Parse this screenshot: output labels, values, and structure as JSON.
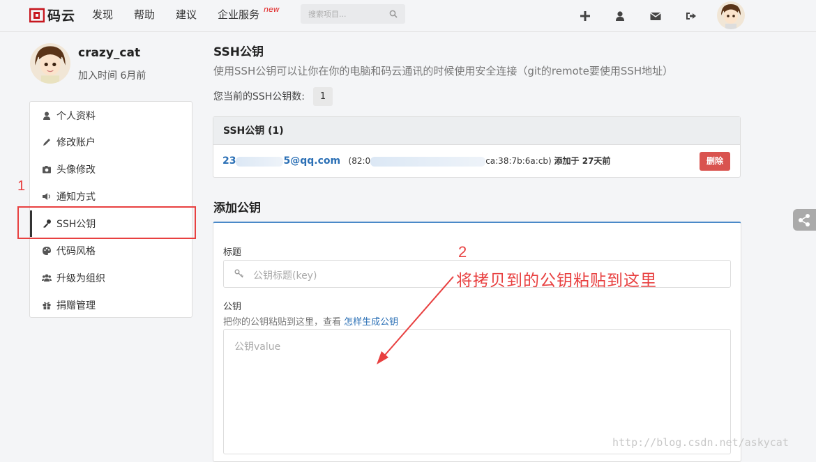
{
  "header": {
    "logo_text": "码云",
    "nav": [
      "发现",
      "帮助",
      "建议",
      "企业服务"
    ],
    "nav_badge": "new",
    "search_placeholder": "搜索项目..."
  },
  "profile": {
    "username": "crazy_cat",
    "joined": "加入时间 6月前"
  },
  "sidebar": {
    "items": [
      {
        "label": "个人资料",
        "icon": "user-icon"
      },
      {
        "label": "修改账户",
        "icon": "pencil-icon"
      },
      {
        "label": "头像修改",
        "icon": "camera-icon"
      },
      {
        "label": "通知方式",
        "icon": "volume-icon"
      },
      {
        "label": "SSH公钥",
        "icon": "key-icon"
      },
      {
        "label": "代码风格",
        "icon": "palette-icon"
      },
      {
        "label": "升级为组织",
        "icon": "users-icon"
      },
      {
        "label": "捐赠管理",
        "icon": "gift-icon"
      }
    ]
  },
  "ssh": {
    "title": "SSH公钥",
    "description": "使用SSH公钥可以让你在你的电脑和码云通讯的时候使用安全连接（git的remote要使用SSH地址）",
    "count_label": "您当前的SSH公钥数:",
    "count": "1",
    "panel_title": "SSH公钥 (1)",
    "key": {
      "email_prefix": "23",
      "email_suffix": "5@qq.com",
      "fingerprint_prefix": "(82:0",
      "fingerprint_suffix": "ca:38:7b:6a:cb)",
      "added": "添加于 27天前"
    },
    "delete_label": "删除"
  },
  "add_key": {
    "title": "添加公钥",
    "title_label": "标题",
    "title_placeholder": "公钥标题(key)",
    "key_label": "公钥",
    "key_hint": "把你的公钥粘贴到这里，查看",
    "key_hint_link": "怎样生成公钥",
    "key_placeholder": "公钥value"
  },
  "annotations": {
    "marker_1": "1",
    "marker_2": "2",
    "instruction": "将拷贝到的公钥粘贴到这里",
    "color": "#e84040"
  },
  "watermark": "http://blog.csdn.net/askycat"
}
